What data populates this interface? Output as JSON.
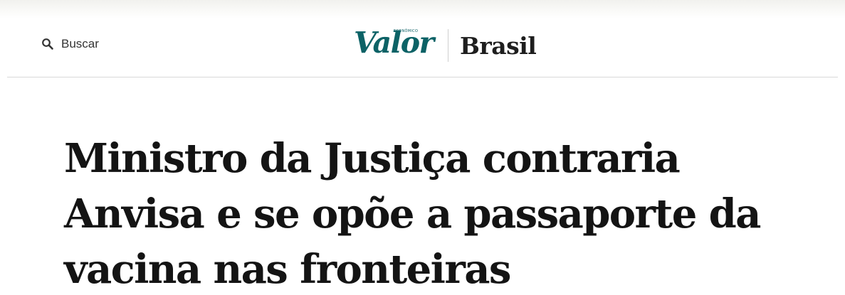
{
  "header": {
    "search_label": "Buscar",
    "logo": {
      "wordmark": "Valor",
      "superscript": "ECONÔMICO"
    },
    "section": "Brasil"
  },
  "article": {
    "headline": "Ministro da Justiça contraria Anvisa e se opõe a passaporte da vacina nas fronteiras"
  },
  "icons": {
    "search": "search-icon"
  },
  "colors": {
    "brand_teal": "#0c6266",
    "headline_text": "#141414",
    "divider": "#d9d9d9"
  }
}
